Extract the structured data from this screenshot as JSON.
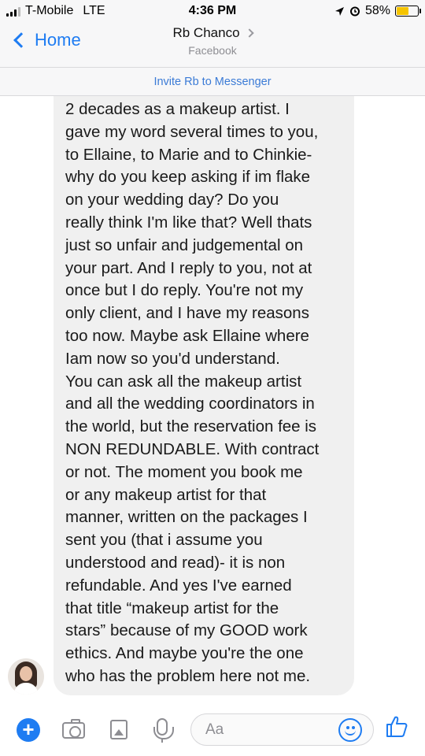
{
  "status_bar": {
    "carrier": "T-Mobile",
    "network": "LTE",
    "time": "4:36 PM",
    "battery_percent": "58%",
    "battery_level": 0.58
  },
  "header": {
    "back_label": "Home",
    "contact_name": "Rb Chanco",
    "contact_source": "Facebook"
  },
  "invite_label": "Invite Rb to Messenger",
  "message": {
    "text": "2 decades as a makeup artist.  I\ngave my word several times to you,\nto Ellaine, to Marie and to Chinkie-\nwhy do you keep asking if im flake\non your wedding day? Do you\nreally think I'm like that? Well thats\njust so unfair and judgemental on\nyour part. And I reply to you, not at\nonce but I do reply. You're not my\nonly client, and I have my reasons\ntoo now. Maybe ask Ellaine where\nIam now so you'd understand.\nYou can ask all the makeup artist\nand all the wedding coordinators in\nthe world, but the reservation fee is\nNON REDUNDABLE. With contract\nor not. The moment you book me\nor any makeup artist for that\nmanner, written on the packages I\nsent you (that i assume you\nunderstood and read)- it is non\nrefundable. And yes I've earned\nthat title “makeup artist for the\nstars” because of my GOOD work\nethics. And maybe you're the one\nwho has the problem here not me."
  },
  "composer": {
    "placeholder": "Aa"
  },
  "colors": {
    "accent": "#1e7cf2",
    "bubble": "#f0f0f0",
    "battery": "#f5c400"
  }
}
